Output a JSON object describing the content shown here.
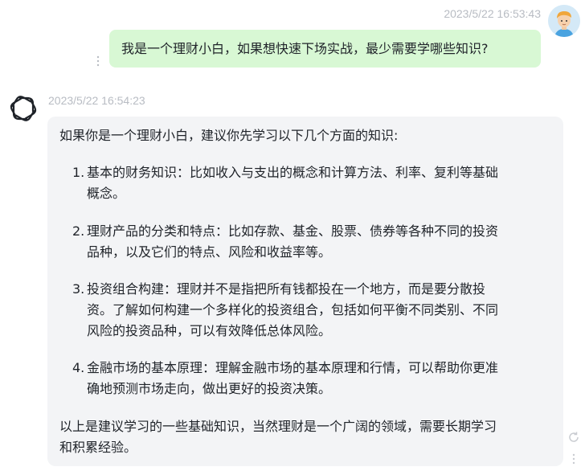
{
  "user_message": {
    "timestamp": "2023/5/22 16:53:43",
    "text": "我是一个理财小白，如果想快速下场实战，最少需要学哪些知识?"
  },
  "bot_message": {
    "timestamp": "2023/5/22 16:54:23",
    "intro": "如果你是一个理财小白，建议你先学习以下几个方面的知识:",
    "items": [
      {
        "number": "1.",
        "lines": [
          "基本的财务知识：比如收入与支出的概念和计算方法、利率、复利等基础",
          "概念。"
        ]
      },
      {
        "number": "2.",
        "lines": [
          "理财产品的分类和特点：比如存款、基金、股票、债券等各种不同的投资",
          "品种，以及它们的特点、风险和收益率等。"
        ]
      },
      {
        "number": "3.",
        "lines": [
          "投资组合构建：理财并不是指把所有钱都投在一个地方，而是要分散投",
          "资。了解如何构建一个多样化的投资组合，包括如何平衡不同类别、不同",
          "风险的投资品种，可以有效降低总体风险。"
        ]
      },
      {
        "number": "4.",
        "lines": [
          "金融市场的基本原理：理解金融市场的基本原理和行情，可以帮助你更准",
          "确地预测市场走向，做出更好的投资决策。"
        ]
      }
    ],
    "outro_lines": [
      "以上是建议学习的一些基础知识，当然理财是一个广阔的领域，需要长期学习",
      "和积累经验。"
    ]
  },
  "icons": {
    "user_avatar": "user-avatar-icon",
    "bot_avatar": "openai-logo-icon",
    "more": "more-vertical-icon",
    "refresh": "refresh-icon"
  }
}
